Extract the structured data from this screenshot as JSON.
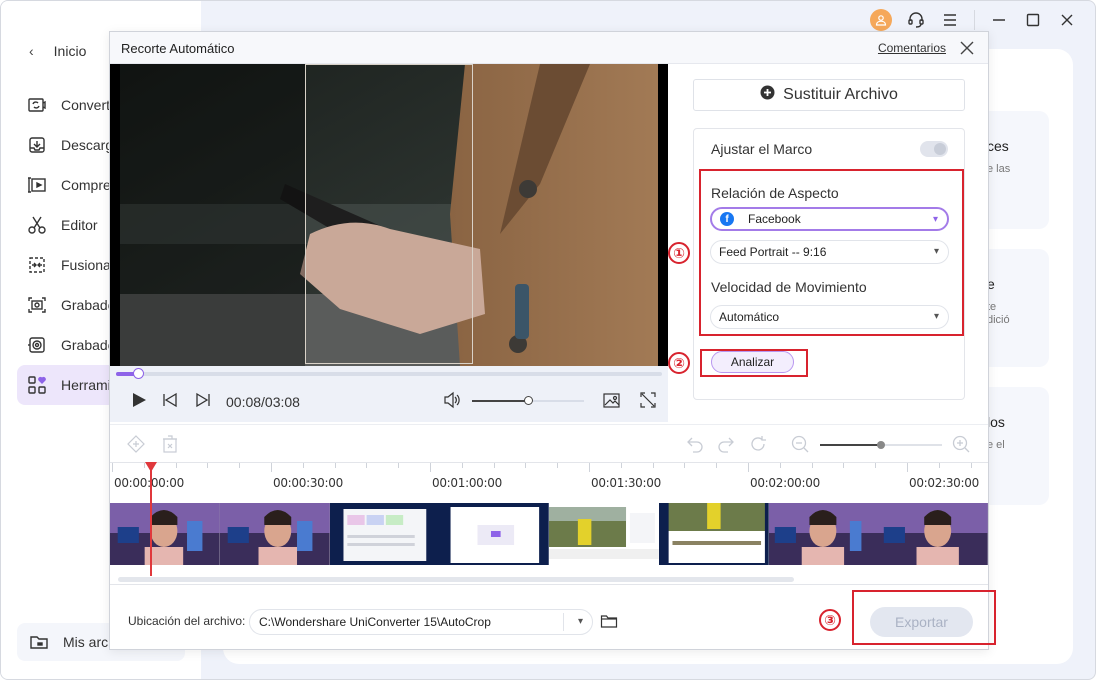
{
  "app": {
    "window_controls": [
      "account-icon",
      "support-icon",
      "menu-icon",
      "minimize-icon",
      "maximize-icon",
      "close-icon"
    ]
  },
  "sidebar": {
    "home_label": "Inicio",
    "items": [
      {
        "label": "Convert",
        "icon": "convert-icon"
      },
      {
        "label": "Descarg",
        "icon": "download-icon"
      },
      {
        "label": "Compre",
        "icon": "compress-icon"
      },
      {
        "label": "Editor",
        "icon": "scissors-icon"
      },
      {
        "label": "Fusionac",
        "icon": "merge-icon"
      },
      {
        "label": "Grabado",
        "icon": "screen-record-icon"
      },
      {
        "label": "Grabado",
        "icon": "audio-record-icon"
      },
      {
        "label": "Herramie",
        "icon": "tools-icon",
        "active": true
      }
    ],
    "my_files_label": "Mis arch"
  },
  "background_cards": [
    {
      "title": "ces",
      "subtitle": "e las"
    },
    {
      "title": "e",
      "subtitle": "te\ndició"
    },
    {
      "title": "los",
      "subtitle": "e el"
    }
  ],
  "dialog": {
    "title": "Recorte Automático",
    "feedback_link": "Comentarios",
    "player": {
      "time": "00:08/03:08",
      "progress_fraction": 0.04,
      "volume_fraction": 0.5
    },
    "settings": {
      "replace_file_label": "Sustituir Archivo",
      "adjust_frame_label": "Ajustar el Marco",
      "adjust_frame_on": false,
      "aspect_ratio_label": "Relación de Aspecto",
      "platform_value": "Facebook",
      "ratio_value": "Feed Portrait -- 9:16",
      "motion_speed_label": "Velocidad de Movimiento",
      "motion_speed_value": "Automático",
      "analyze_label": "Analizar"
    },
    "annotations": [
      "①",
      "②",
      "③"
    ],
    "timeline": {
      "zoom_fraction": 0.5,
      "ticks": [
        "00:00:00:00",
        "00:00:30:00",
        "00:01:00:00",
        "00:01:30:00",
        "00:02:00:00",
        "00:02:30:00"
      ]
    },
    "footer": {
      "location_label": "Ubicación del archivo:",
      "location_value": "C:\\Wondershare UniConverter 15\\AutoCrop",
      "export_label": "Exportar"
    }
  },
  "colors": {
    "accent": "#8e63e8",
    "annotation_red": "#d8232e",
    "playhead": "#e0383c",
    "avatar": "#f5a85a",
    "facebook": "#1877f2"
  }
}
